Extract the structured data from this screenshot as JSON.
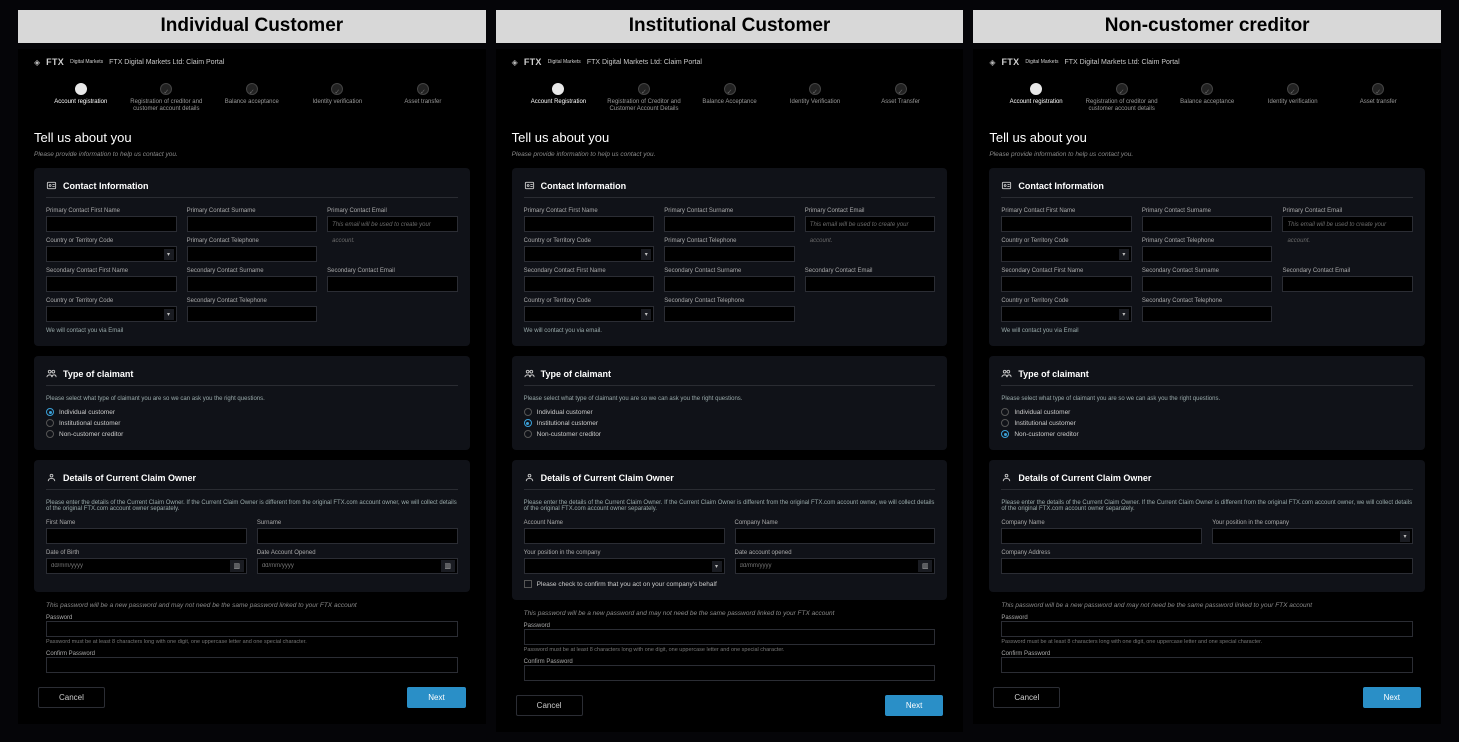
{
  "columns": [
    {
      "col_title": "Individual Customer",
      "brand": {
        "ftx": "FTX",
        "dm": "Digital\nMarkets",
        "portal": "FTX Digital Markets Ltd: Claim Portal"
      },
      "steps": [
        {
          "label": "Account registration",
          "state": "current"
        },
        {
          "label": "Registration of creditor and customer account details",
          "state": "pending"
        },
        {
          "label": "Balance acceptance",
          "state": "pending"
        },
        {
          "label": "Identity verification",
          "state": "pending"
        },
        {
          "label": "Asset transfer",
          "state": "pending"
        }
      ],
      "heading": "Tell us about you",
      "subheading": "Please provide information to help us contact you.",
      "contact": {
        "section_title": "Contact Information",
        "primary_first": "Primary Contact First Name",
        "primary_surname": "Primary Contact Surname",
        "primary_email": "Primary Contact Email",
        "primary_email_helper": "This email will be used to create your account.",
        "country_code": "Country or Territory Code",
        "primary_tel": "Primary Contact Telephone",
        "sec_first": "Secondary Contact First Name",
        "sec_surname": "Secondary Contact Surname",
        "sec_email": "Secondary Contact Email",
        "sec_country": "Country or Territory Code",
        "sec_tel": "Secondary Contact Telephone",
        "foot": "We will contact you via Email"
      },
      "claimant": {
        "section_title": "Type of claimant",
        "prompt": "Please select what type of claimant you are so we can ask you the right questions.",
        "options": [
          "Individual customer",
          "Institutional customer",
          "Non-customer creditor"
        ],
        "selected": 0
      },
      "details": {
        "section_title": "Details of Current Claim Owner",
        "prompt": "Please enter the details of the Current Claim Owner. If the Current Claim Owner is different from the original FTX.com account owner, we will collect details of the original FTX.com account owner separately.",
        "fields": [
          [
            {
              "label": "First Name",
              "type": "text"
            },
            {
              "label": "Surname",
              "type": "text"
            }
          ],
          [
            {
              "label": "Date of Birth",
              "type": "date",
              "placeholder": "dd/mm/yyyy"
            },
            {
              "label": "Date Account Opened",
              "type": "date",
              "placeholder": "dd/mm/yyyy"
            }
          ]
        ],
        "confirm_checkbox": null
      },
      "password": {
        "note": "This password will be a new password and may not need be the same password linked to your FTX account",
        "pw_label": "Password",
        "pw_help": "Password must be at least 8 characters long with one digit, one uppercase letter and one special character.",
        "confirm_label": "Confirm Password"
      },
      "buttons": {
        "cancel": "Cancel",
        "next": "Next"
      }
    },
    {
      "col_title": "Institutional Customer",
      "brand": {
        "ftx": "FTX",
        "dm": "Digital\nMarkets",
        "portal": "FTX Digital Markets Ltd: Claim Portal"
      },
      "steps": [
        {
          "label": "Account Registration",
          "state": "current"
        },
        {
          "label": "Registration of Creditor and Customer Account Details",
          "state": "pending"
        },
        {
          "label": "Balance Acceptance",
          "state": "pending"
        },
        {
          "label": "Identity Verification",
          "state": "pending"
        },
        {
          "label": "Asset Transfer",
          "state": "pending"
        }
      ],
      "heading": "Tell us about you",
      "subheading": "Please provide information to help us contact you.",
      "contact": {
        "section_title": "Contact Information",
        "primary_first": "Primary Contact First Name",
        "primary_surname": "Primary Contact Surname",
        "primary_email": "Primary Contact Email",
        "primary_email_helper": "This email will be used to create your account.",
        "country_code": "Country or Territory Code",
        "primary_tel": "Primary Contact Telephone",
        "sec_first": "Secondary Contact First Name",
        "sec_surname": "Secondary Contact Surname",
        "sec_email": "Secondary Contact Email",
        "sec_country": "Country or Territory Code",
        "sec_tel": "Secondary Contact Telephone",
        "foot": "We will contact you via email."
      },
      "claimant": {
        "section_title": "Type of claimant",
        "prompt": "Please select what type of claimant you are so we can ask you the right questions.",
        "options": [
          "Individual customer",
          "Institutional customer",
          "Non-customer creditor"
        ],
        "selected": 1
      },
      "details": {
        "section_title": "Details of Current Claim Owner",
        "prompt": "Please enter the details of the Current Claim Owner. If the Current Claim Owner is different from the original FTX.com account owner, we will collect details of the original FTX.com account owner separately.",
        "fields": [
          [
            {
              "label": "Account Name",
              "type": "text"
            },
            {
              "label": "Company Name",
              "type": "text"
            }
          ],
          [
            {
              "label": "Your position in the company",
              "type": "select"
            },
            {
              "label": "Date account opened",
              "type": "date",
              "placeholder": "dd/mm/yyyy"
            }
          ]
        ],
        "confirm_checkbox": "Please check to confirm that you act on your company's behalf"
      },
      "password": {
        "note": "This password will be a new password and may not need be the same password linked to your FTX account",
        "pw_label": "Password",
        "pw_help": "Password must be at least 8 characters long with one digit, one uppercase letter and one special character.",
        "confirm_label": "Confirm Password"
      },
      "buttons": {
        "cancel": "Cancel",
        "next": "Next"
      }
    },
    {
      "col_title": "Non-customer creditor",
      "brand": {
        "ftx": "FTX",
        "dm": "Digital\nMarkets",
        "portal": "FTX Digital Markets Ltd: Claim Portal"
      },
      "steps": [
        {
          "label": "Account registration",
          "state": "current"
        },
        {
          "label": "Registration of creditor and customer account details",
          "state": "pending"
        },
        {
          "label": "Balance acceptance",
          "state": "pending"
        },
        {
          "label": "Identity verification",
          "state": "pending"
        },
        {
          "label": "Asset transfer",
          "state": "pending"
        }
      ],
      "heading": "Tell us about you",
      "subheading": "Please provide information to help us contact you.",
      "contact": {
        "section_title": "Contact Information",
        "primary_first": "Primary Contact First Name",
        "primary_surname": "Primary Contact Surname",
        "primary_email": "Primary Contact Email",
        "primary_email_helper": "This email will be used to create your account.",
        "country_code": "Country or Territory Code",
        "primary_tel": "Primary Contact Telephone",
        "sec_first": "Secondary Contact First Name",
        "sec_surname": "Secondary Contact Surname",
        "sec_email": "Secondary Contact Email",
        "sec_country": "Country or Territory Code",
        "sec_tel": "Secondary Contact Telephone",
        "foot": "We will contact you via Email"
      },
      "claimant": {
        "section_title": "Type of claimant",
        "prompt": "Please select what type of claimant you are so we can ask you the right questions.",
        "options": [
          "Individual customer",
          "Institutional customer",
          "Non-customer creditor"
        ],
        "selected": 2
      },
      "details": {
        "section_title": "Details of Current Claim Owner",
        "prompt": "Please enter the details of the Current Claim Owner. If the Current Claim Owner is different from the original FTX.com account owner, we will collect details of the original FTX.com account owner separately.",
        "fields": [
          [
            {
              "label": "Company Name",
              "type": "text"
            },
            {
              "label": "Your position in the company",
              "type": "select"
            }
          ],
          [
            {
              "label": "Company Address",
              "type": "text"
            }
          ]
        ],
        "confirm_checkbox": null
      },
      "password": {
        "note": "This password will be a new password and may not need be the same password linked to your FTX account",
        "pw_label": "Password",
        "pw_help": "Password must be at least 8 characters long with one digit, one uppercase letter and one special character.",
        "confirm_label": "Confirm Password"
      },
      "buttons": {
        "cancel": "Cancel",
        "next": "Next"
      }
    }
  ]
}
